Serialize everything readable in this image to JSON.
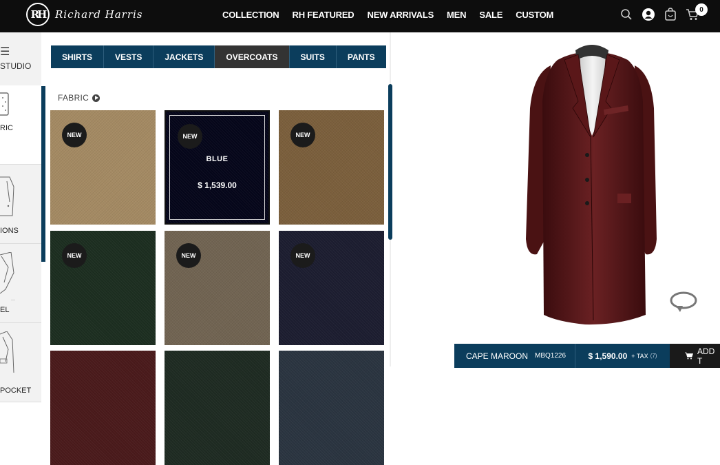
{
  "brand": {
    "mark": "RH",
    "name": "Richard Harris"
  },
  "nav": [
    "COLLECTION",
    "RH FEATURED",
    "NEW ARRIVALS",
    "MEN",
    "SALE",
    "CUSTOM"
  ],
  "header_icons": {
    "search": "search-icon",
    "account": "user-icon",
    "wishlist": "bag-icon",
    "cart": "cart-icon",
    "cart_count": "0"
  },
  "sidebar": {
    "menu_icon": "☰",
    "studio_label": "STUDIO",
    "items": [
      {
        "label": "RIC",
        "icon": "fabric-icon"
      },
      {
        "label": "IONS",
        "icon": "options-icon"
      },
      {
        "label": "EL",
        "icon": "lapel-icon"
      },
      {
        "label": "POCKET",
        "icon": "pocket-icon"
      }
    ]
  },
  "tabs": [
    "SHIRTS",
    "VESTS",
    "JACKETS",
    "OVERCOATS",
    "SUITS",
    "PANTS"
  ],
  "active_tab": "OVERCOATS",
  "section_label": "FABRIC",
  "swatches": [
    {
      "badge": "NEW",
      "color": "#a48a63"
    },
    {
      "badge": "NEW",
      "color": "#05061a",
      "name": "BLUE",
      "price": "$ 1,539.00",
      "selected": true
    },
    {
      "badge": "NEW",
      "color": "#7b5f3c"
    },
    {
      "badge": "NEW",
      "color": "#1c2e20"
    },
    {
      "badge": "NEW",
      "color": "#716452"
    },
    {
      "badge": "NEW",
      "color": "#1c1d30"
    },
    {
      "badge": "",
      "color": "#4a1a1b"
    },
    {
      "badge": "",
      "color": "#1e2b22"
    },
    {
      "badge": "",
      "color": "#2a3440"
    }
  ],
  "product": {
    "name": "CAPE MAROON",
    "code": "MBQ1226",
    "price": "$ 1,590.00",
    "tax_label": "+ TAX",
    "tax_note": "(7)",
    "add_label": "ADD T",
    "coat_color": "#5a1a1c"
  }
}
